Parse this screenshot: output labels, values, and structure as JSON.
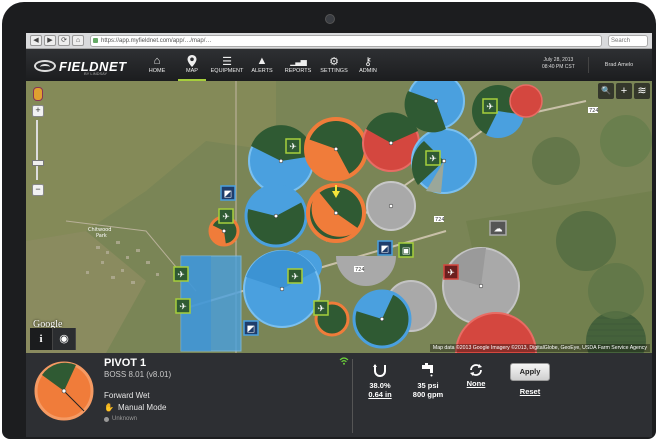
{
  "browser": {
    "url": "https://app.myfieldnet.com/app/…/map/…",
    "nav_buttons": [
      "◀",
      "▶",
      "⟳",
      "⌂"
    ],
    "search_placeholder": "Search"
  },
  "nav": {
    "brand": "FIELDNET",
    "brand_sub": "BY LINDSAY",
    "items": [
      {
        "label": "HOME",
        "icon": "home-icon",
        "glyph": "⌂"
      },
      {
        "label": "MAP",
        "icon": "map-pin-icon",
        "glyph": "⚲",
        "active": true
      },
      {
        "label": "EQUIPMENT",
        "icon": "list-icon",
        "glyph": "☰"
      },
      {
        "label": "ALERTS",
        "icon": "warning-icon",
        "glyph": "▲"
      },
      {
        "label": "REPORTS",
        "icon": "chart-icon",
        "glyph": "▁▃▅"
      },
      {
        "label": "SETTINGS",
        "icon": "gear-icon",
        "glyph": "⚙"
      },
      {
        "label": "ADMIN",
        "icon": "key-icon",
        "glyph": "⚷"
      }
    ],
    "date": "July 28, 2013",
    "time": "08:40 PM CST",
    "user": "Brad Amelo"
  },
  "map": {
    "tools": [
      {
        "name": "search-icon",
        "glyph": "🔍"
      },
      {
        "name": "crosshair-icon",
        "glyph": "+"
      },
      {
        "name": "layers-icon",
        "glyph": "≋"
      }
    ],
    "zoom_plus": "+",
    "zoom_minus": "−",
    "google_label": "Google",
    "attribution": "Map data ©2013 Google Imagery ©2013, DigitalGlobe, GeoEye, USDA Farm Service Agency",
    "place_label": "Chitwood\nPark",
    "road_labels": [
      "724",
      "724",
      "724"
    ],
    "tabs": [
      {
        "name": "info-tab",
        "glyph": "i"
      },
      {
        "name": "globe-tab",
        "glyph": "◉"
      }
    ]
  },
  "pivot": {
    "name": "PIVOT 1",
    "model": "BOSS 8.01 (v8.01)",
    "direction": "Forward Wet",
    "mode": "Manual Mode",
    "connection": "Unknown"
  },
  "controls": {
    "depth_percent": "38.0%",
    "depth_inches": "0.64 in",
    "pressure": "35 psi",
    "flow": "800 gpm",
    "stop_mode": "None",
    "apply_label": "Apply",
    "reset_label": "Reset"
  },
  "colors": {
    "orange": "#f07c3a",
    "blue": "#4aa0df",
    "red": "#d4473f",
    "gray": "#a9a9a9",
    "green_accent": "#a6cf3c",
    "field_green": "#2f5a33"
  }
}
